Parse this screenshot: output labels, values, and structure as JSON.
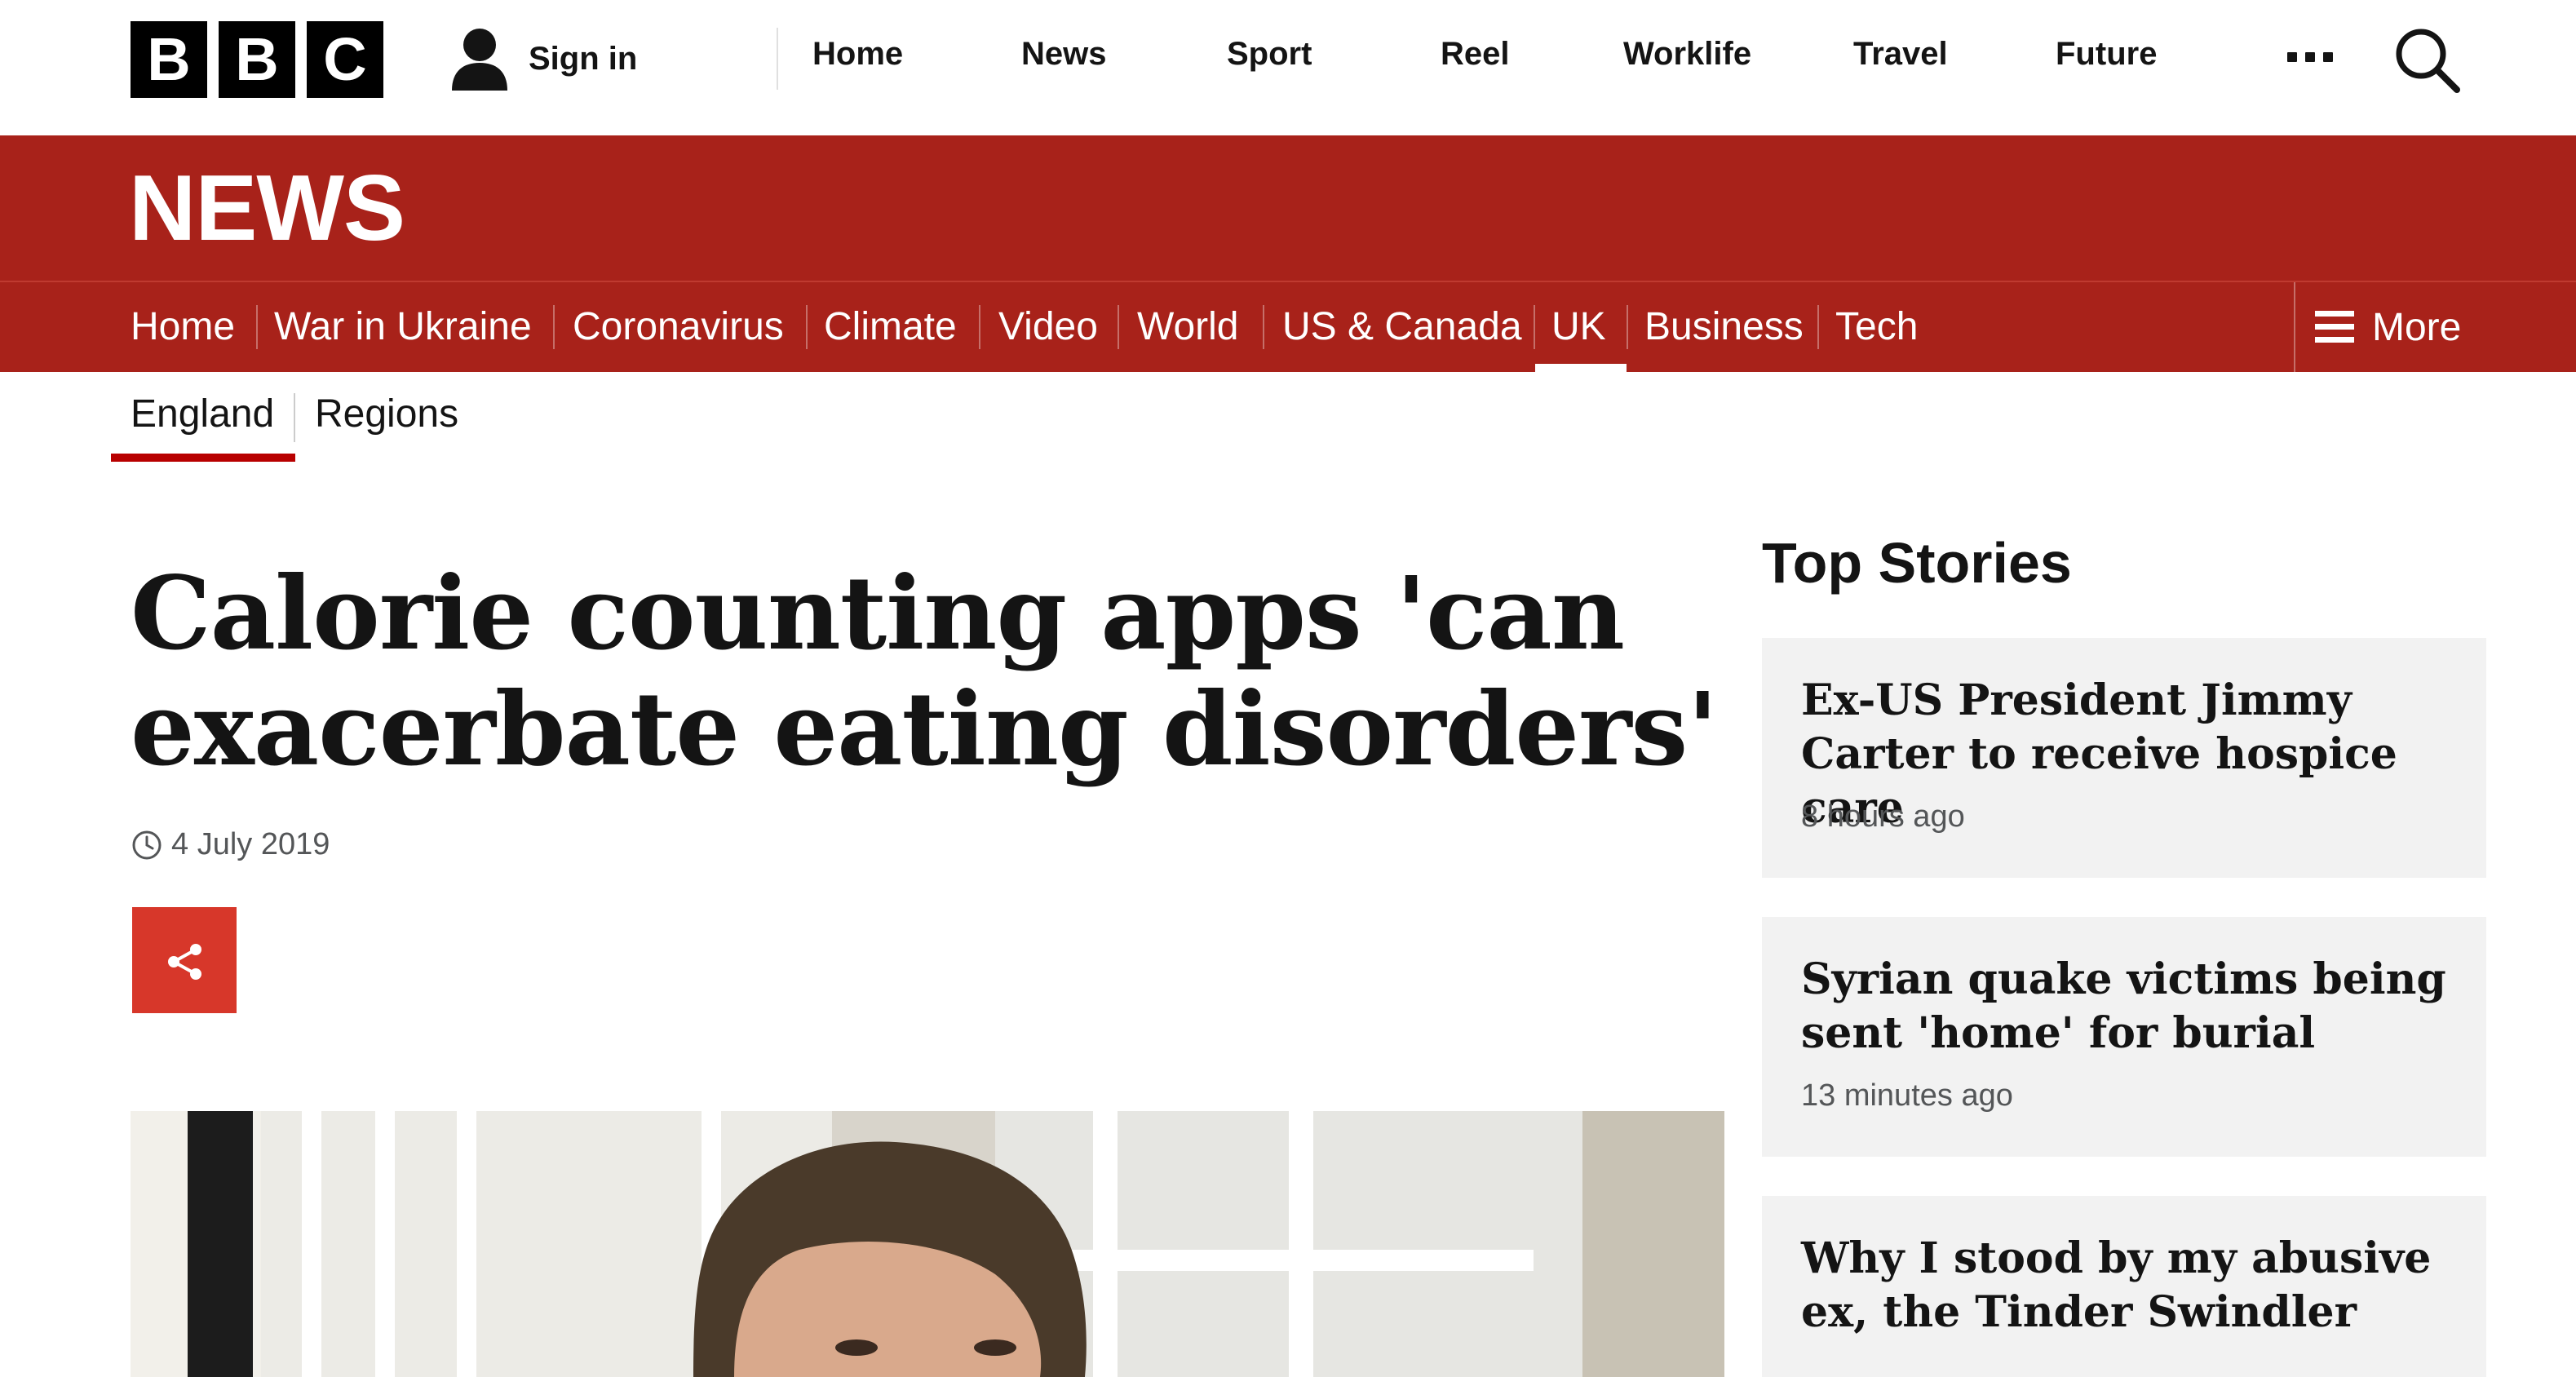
{
  "brand": {
    "logo_letters": [
      "B",
      "B",
      "C"
    ]
  },
  "header": {
    "signin_label": "Sign in",
    "nav": [
      "Home",
      "News",
      "Sport",
      "Reel",
      "Worklife",
      "Travel",
      "Future"
    ],
    "more_icon": "ellipsis-icon",
    "search_icon": "search-icon"
  },
  "news_band": {
    "title": "NEWS"
  },
  "section_nav": {
    "items": [
      "Home",
      "War in Ukraine",
      "Coronavirus",
      "Climate",
      "Video",
      "World",
      "US & Canada",
      "UK",
      "Business",
      "Tech"
    ],
    "active": "UK",
    "more_label": "More"
  },
  "sub_nav": {
    "items": [
      "England",
      "Regions"
    ],
    "active": "England"
  },
  "article": {
    "headline": "Calorie counting apps 'can exacerbate eating disorders'",
    "date": "4 July 2019",
    "share_icon": "share-icon"
  },
  "top_stories": {
    "title": "Top Stories",
    "items": [
      {
        "headline": "Ex-US President Jimmy Carter to receive hospice care",
        "time": "8 hours ago"
      },
      {
        "headline": "Syrian quake victims being sent 'home' for burial",
        "time": "13 minutes ago"
      },
      {
        "headline": "Why I stood by my abusive ex, the Tinder Swindler",
        "time": ""
      }
    ]
  },
  "colors": {
    "bbc_red": "#a8221a",
    "share_red": "#d7372a",
    "card_bg": "#f2f2f2",
    "underline_red": "#b80000"
  }
}
